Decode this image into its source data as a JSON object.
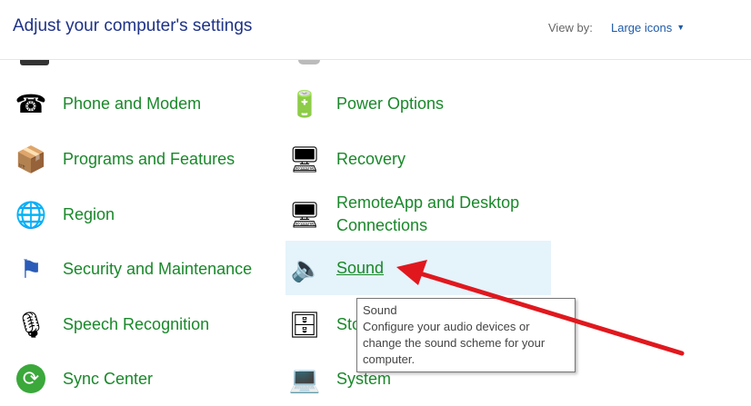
{
  "header": {
    "title": "Adjust your computer's settings",
    "view_by_label": "View by:",
    "view_by_value": "Large icons"
  },
  "left_items": [
    {
      "label": "Phone and Modem",
      "icon": "phone-modem-icon"
    },
    {
      "label": "Programs and Features",
      "icon": "programs-icon"
    },
    {
      "label": "Region",
      "icon": "globe-clock-icon"
    },
    {
      "label": "Security and Maintenance",
      "icon": "flag-icon"
    },
    {
      "label": "Speech Recognition",
      "icon": "microphone-icon"
    },
    {
      "label": "Sync Center",
      "icon": "sync-icon"
    }
  ],
  "right_items": [
    {
      "label": "Power Options",
      "icon": "battery-icon"
    },
    {
      "label": "Recovery",
      "icon": "recovery-icon"
    },
    {
      "label": "RemoteApp and Desktop Connections",
      "icon": "remoteapp-icon"
    },
    {
      "label": "Sound",
      "icon": "speaker-icon"
    },
    {
      "label": "Storage Spaces",
      "icon": "storage-icon"
    },
    {
      "label": "System",
      "icon": "computer-icon"
    }
  ],
  "tooltip": {
    "title": "Sound",
    "description": "Configure your audio devices or change the sound scheme for your computer."
  },
  "colors": {
    "link": "#19882a",
    "title": "#1e3287",
    "arrow": "#e0181e",
    "highlight": "#e5f3fb"
  }
}
